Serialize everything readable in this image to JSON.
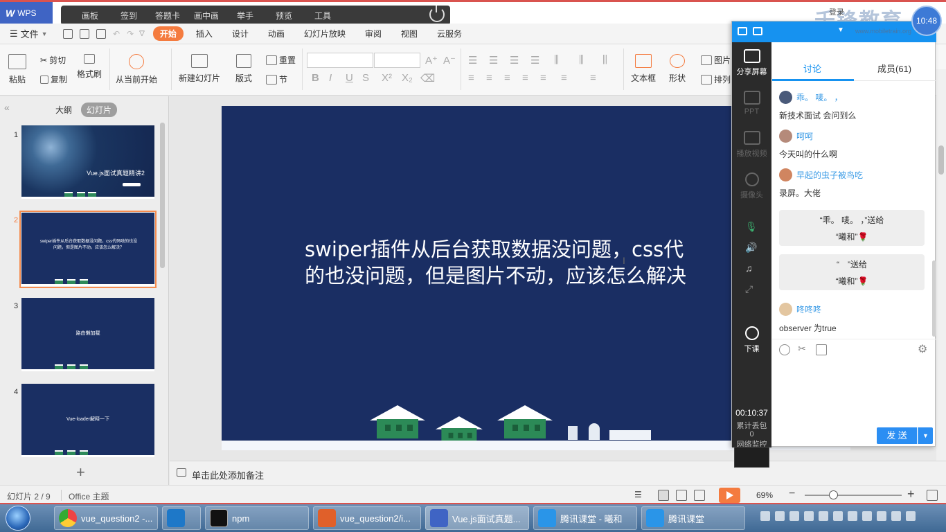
{
  "titlebar": {
    "app_name": "WPS",
    "login": "登录",
    "watermark": "千锋教育",
    "watermark_url": "www.mobiletrain.org",
    "time_badge": "10:48",
    "float_toolbar": [
      "画板",
      "签到",
      "答题卡",
      "画中画",
      "举手",
      "预览",
      "工具"
    ]
  },
  "menubar": {
    "file_label": "文件",
    "tabs": [
      "开始",
      "插入",
      "设计",
      "动画",
      "幻灯片放映",
      "审阅",
      "视图",
      "云服务"
    ],
    "active_tab": "开始"
  },
  "ribbon": {
    "paste": "粘贴",
    "cut": "剪切",
    "copy": "复制",
    "format_painter": "格式刷",
    "from_current": "从当前开始",
    "new_slide": "新建幻灯片",
    "layout": "版式",
    "reset": "重置",
    "section": "节",
    "text_box": "文本框",
    "shapes": "形状",
    "picture": "图片",
    "arrange": "排列"
  },
  "left_panel": {
    "tab_outline": "大纲",
    "tab_slides": "幻灯片",
    "slides": [
      {
        "num": "1",
        "title": "Vue.js面试真题精讲2"
      },
      {
        "num": "2",
        "title": "swiper插件从后台获取数据没问题，css代码啥的也没问题，但是图片不动，应该怎么解决？"
      },
      {
        "num": "3",
        "title": "路由懒加载"
      },
      {
        "num": "4",
        "title": "Vue-loader解释一下"
      }
    ]
  },
  "slide": {
    "line1": "swiper插件从后台获取数据没问题，css代",
    "line2": "的也没问题，但是图片不动，应该怎么解决"
  },
  "notes": {
    "placeholder": "单击此处添加备注"
  },
  "statusbar": {
    "slide_counter": "幻灯片 2 / 9",
    "theme": "Office 主题",
    "zoom": "69%",
    "zoom_level": 0.29
  },
  "tencent": {
    "sidebar": {
      "share_screen": "分享屏幕",
      "ppt": "PPT",
      "play_video": "播放视频",
      "camera": "摄像头",
      "end_class": "下课",
      "timer": "00:10:37",
      "packet_loss": "累计丢包",
      "packet_loss_value": "0",
      "network_monitor": "网络监控"
    },
    "tabs": {
      "discussion": "讨论",
      "members": "成员(61)"
    },
    "messages": [
      {
        "user": "乖。 唛。 ，",
        "text": "新技术面试 会问到么"
      },
      {
        "user": "呵呵",
        "text": "今天叫的什么啊"
      },
      {
        "user": "早起的虫子被鸟吃",
        "text": "录屏。大佬"
      }
    ],
    "gifts": [
      {
        "line1": "“乖。 唛。 ，”送给",
        "line2": "“曦和”"
      },
      {
        "line1": "“　”送给",
        "line2": "“曦和”"
      }
    ],
    "last_message": {
      "user": "咚咚咚",
      "text": "observer 为true"
    },
    "send": "发 送"
  },
  "taskbar": {
    "items": [
      "vue_question2 -...",
      "npm",
      "vue_question2/i...",
      "Vue.js面试真题...",
      "腾讯课堂 - 曦和",
      "腾讯课堂"
    ]
  },
  "colors": {
    "accent_orange": "#f47b3f",
    "slide_bg": "#1a2e63",
    "tencent_blue": "#1692f0",
    "titlebar_red": "#d9534f"
  }
}
